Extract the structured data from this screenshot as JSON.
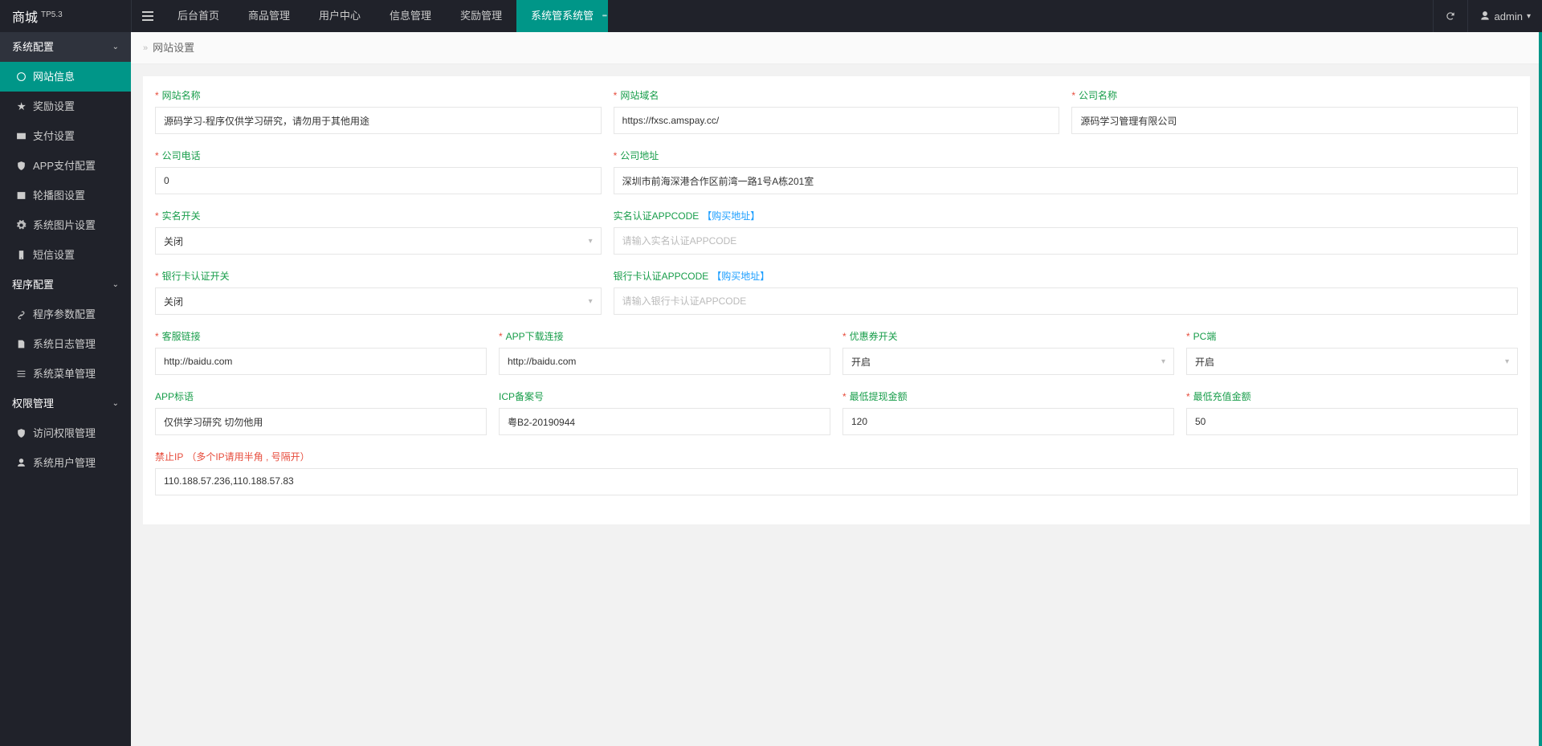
{
  "header": {
    "brand": "商城",
    "version": "TP5.3",
    "nav": [
      "后台首页",
      "商品管理",
      "用户中心",
      "信息管理",
      "奖励管理",
      "系统管系统管"
    ],
    "nav_active_index": 5,
    "user": "admin",
    "refresh_title": "刷新"
  },
  "breadcrumb": {
    "title": "网站设置"
  },
  "sidebar": {
    "groups": [
      {
        "label": "系统配置",
        "expanded": true,
        "items": [
          {
            "label": "网站信息",
            "icon": "globe",
            "active": true
          },
          {
            "label": "奖励设置",
            "icon": "star"
          },
          {
            "label": "支付设置",
            "icon": "card"
          },
          {
            "label": "APP支付配置",
            "icon": "shield"
          },
          {
            "label": "轮播图设置",
            "icon": "image"
          },
          {
            "label": "系统图片设置",
            "icon": "gear"
          },
          {
            "label": "短信设置",
            "icon": "phone"
          }
        ]
      },
      {
        "label": "程序配置",
        "expanded": true,
        "items": [
          {
            "label": "程序参数配置",
            "icon": "link"
          },
          {
            "label": "系统日志管理",
            "icon": "doc"
          },
          {
            "label": "系统菜单管理",
            "icon": "menu"
          }
        ]
      },
      {
        "label": "权限管理",
        "expanded": true,
        "items": [
          {
            "label": "访问权限管理",
            "icon": "shield"
          },
          {
            "label": "系统用户管理",
            "icon": "user"
          }
        ]
      }
    ]
  },
  "form": {
    "row1": {
      "site_name": {
        "label": "网站名称",
        "required": true,
        "value": "源码学习-程序仅供学习研究，请勿用于其他用途"
      },
      "site_domain": {
        "label": "网站域名",
        "required": true,
        "value": "https://fxsc.amspay.cc/"
      },
      "company_name": {
        "label": "公司名称",
        "required": true,
        "value": "源码学习管理有限公司"
      }
    },
    "row2": {
      "company_phone": {
        "label": "公司电话",
        "required": true,
        "value": "0"
      },
      "company_address": {
        "label": "公司地址",
        "required": true,
        "value": "深圳市前海深港合作区前湾一路1号A栋201室"
      }
    },
    "row3": {
      "realname_switch": {
        "label": "实名开关",
        "required": true,
        "value": "关闭"
      },
      "realname_appcode": {
        "label": "实名认证APPCODE",
        "link": "【购买地址】",
        "placeholder": "请输入实名认证APPCODE",
        "value": ""
      }
    },
    "row4": {
      "bank_switch": {
        "label": "银行卡认证开关",
        "required": true,
        "value": "关闭"
      },
      "bank_appcode": {
        "label": "银行卡认证APPCODE",
        "link": "【购买地址】",
        "placeholder": "请输入银行卡认证APPCODE",
        "value": ""
      }
    },
    "row5": {
      "kefu_link": {
        "label": "客服链接",
        "required": true,
        "value": "http://baidu.com"
      },
      "app_download": {
        "label": "APP下载连接",
        "required": true,
        "value": "http://baidu.com"
      },
      "coupon_switch": {
        "label": "优惠券开关",
        "required": true,
        "value": "开启"
      },
      "pc_switch": {
        "label": "PC端",
        "required": true,
        "value": "开启"
      }
    },
    "row6": {
      "app_slogan": {
        "label": "APP标语",
        "value": "仅供学习研究 切勿他用"
      },
      "icp": {
        "label": "ICP备案号",
        "value": "粤B2-20190944"
      },
      "min_withdraw": {
        "label": "最低提现金额",
        "required": true,
        "value": "120"
      },
      "min_recharge": {
        "label": "最低充值金额",
        "required": true,
        "value": "50"
      }
    },
    "row7": {
      "ban_ip": {
        "label": "禁止IP",
        "hint": "（多个IP请用半角 , 号隔开）",
        "value": "110.188.57.236,110.188.57.83"
      }
    }
  }
}
